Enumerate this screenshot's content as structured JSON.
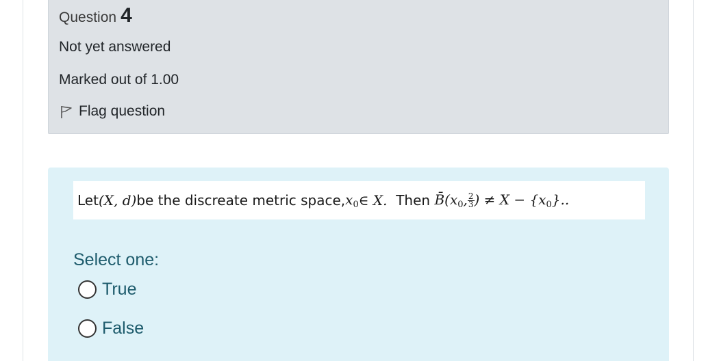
{
  "info": {
    "question_label": "Question",
    "question_number": "4",
    "status": "Not yet answered",
    "grade": "Marked out of 1.00",
    "flag_label": "Flag question"
  },
  "question": {
    "text_part1": "Let ",
    "math_space": "(X, d)",
    "text_part2": " be the discreate metric space, ",
    "math_point": "x",
    "math_point_sub": "0",
    "math_in": " ∈ X.",
    "text_then": "  Then ",
    "math_ball": "B̄",
    "math_ball_open": "(x",
    "math_ball_sub": "0",
    "math_ball_comma": ",",
    "frac_num": "2",
    "frac_den": "3",
    "math_ball_close": ") ≠ X − {x",
    "math_set_sub": "0",
    "math_set_close": "}..",
    "prompt": "Select one:"
  },
  "options": [
    {
      "label": "True",
      "selected": false
    },
    {
      "label": "False",
      "selected": false
    }
  ]
}
